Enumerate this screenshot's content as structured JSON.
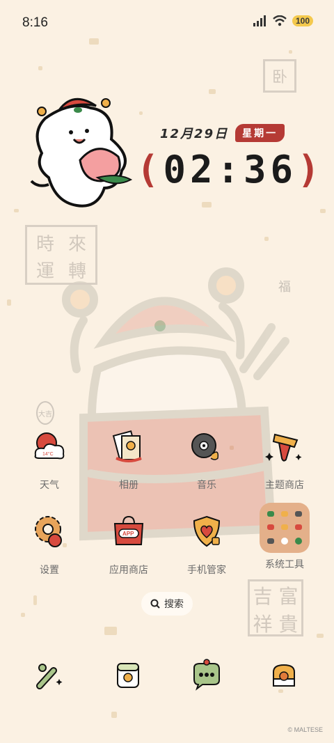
{
  "status_bar": {
    "time": "8:16",
    "battery": "100"
  },
  "stamps": {
    "top_right": "卧",
    "left_big": [
      "時",
      "來",
      "運",
      "轉"
    ],
    "small_right": "福",
    "small_left": "大吉",
    "bottom_right": [
      "吉",
      "富",
      "祥",
      "貴"
    ]
  },
  "widget": {
    "date": "12月29日",
    "weekday": "星期一",
    "clock": "02:36",
    "paren_left": "(",
    "paren_right": ")"
  },
  "apps": [
    {
      "label": "天气",
      "badge": "14°C"
    },
    {
      "label": "相册"
    },
    {
      "label": "音乐"
    },
    {
      "label": "主题商店"
    },
    {
      "label": "设置"
    },
    {
      "label": "应用商店",
      "badge": "APP"
    },
    {
      "label": "手机管家"
    },
    {
      "label": "系统工具"
    }
  ],
  "search": {
    "label": "搜索"
  },
  "dock": [
    "bone-icon",
    "notes-icon",
    "message-icon",
    "basket-icon"
  ],
  "copyright": "© MALTESE"
}
